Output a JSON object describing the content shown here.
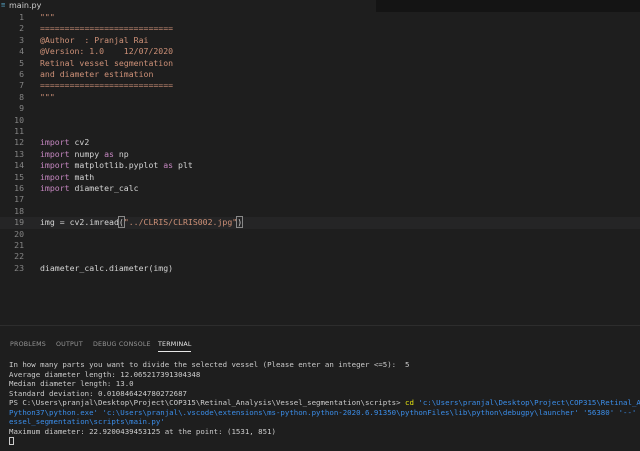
{
  "tab": {
    "file_name": "main.py"
  },
  "editor": {
    "lines": [
      {
        "n": "1",
        "segments": [
          {
            "t": "\"\"\"",
            "c": "str"
          }
        ]
      },
      {
        "n": "2",
        "segments": [
          {
            "t": "===========================",
            "c": "str"
          }
        ]
      },
      {
        "n": "3",
        "segments": [
          {
            "t": "@Author  : Pranjal Rai",
            "c": "str"
          }
        ]
      },
      {
        "n": "4",
        "segments": [
          {
            "t": "@Version: 1.0    12/07/2020",
            "c": "str"
          }
        ]
      },
      {
        "n": "5",
        "segments": [
          {
            "t": "Retinal vessel segmentation",
            "c": "str"
          }
        ]
      },
      {
        "n": "6",
        "segments": [
          {
            "t": "and diameter estimation",
            "c": "str"
          }
        ]
      },
      {
        "n": "7",
        "segments": [
          {
            "t": "===========================",
            "c": "str"
          }
        ]
      },
      {
        "n": "8",
        "segments": [
          {
            "t": "\"\"\"",
            "c": "str"
          }
        ]
      },
      {
        "n": "9",
        "segments": []
      },
      {
        "n": "10",
        "segments": []
      },
      {
        "n": "11",
        "segments": []
      },
      {
        "n": "12",
        "segments": [
          {
            "t": "import",
            "c": "kw"
          },
          {
            "t": " cv2",
            "c": ""
          }
        ]
      },
      {
        "n": "13",
        "segments": [
          {
            "t": "import",
            "c": "kw"
          },
          {
            "t": " numpy ",
            "c": ""
          },
          {
            "t": "as",
            "c": "kw"
          },
          {
            "t": " np",
            "c": ""
          }
        ]
      },
      {
        "n": "14",
        "segments": [
          {
            "t": "import",
            "c": "kw"
          },
          {
            "t": " matplotlib.pyplot ",
            "c": ""
          },
          {
            "t": "as",
            "c": "kw"
          },
          {
            "t": " plt",
            "c": ""
          }
        ]
      },
      {
        "n": "15",
        "segments": [
          {
            "t": "import",
            "c": "kw"
          },
          {
            "t": " math",
            "c": ""
          }
        ]
      },
      {
        "n": "16",
        "segments": [
          {
            "t": "import",
            "c": "kw"
          },
          {
            "t": " diameter_calc",
            "c": ""
          }
        ]
      },
      {
        "n": "17",
        "segments": []
      },
      {
        "n": "18",
        "segments": []
      },
      {
        "n": "19",
        "segments": [
          {
            "t": "img = cv2.imread",
            "c": ""
          },
          {
            "t": "(",
            "c": "box"
          },
          {
            "t": "\"../CLRIS/CLRIS002.jpg\"",
            "c": "str"
          },
          {
            "t": ")",
            "c": "box"
          }
        ],
        "current": true
      },
      {
        "n": "20",
        "segments": []
      },
      {
        "n": "21",
        "segments": []
      },
      {
        "n": "22",
        "segments": []
      },
      {
        "n": "23",
        "segments": [
          {
            "t": "diameter_calc.diameter(img)",
            "c": ""
          }
        ]
      }
    ]
  },
  "panel": {
    "tabs": [
      {
        "label": "PROBLEMS",
        "active": false
      },
      {
        "label": "OUTPUT",
        "active": false
      },
      {
        "label": "DEBUG CONSOLE",
        "active": false
      },
      {
        "label": "TERMINAL",
        "active": true
      }
    ],
    "terminal_lines": [
      "In how many parts you want to divide the selected vessel (Please enter an integer <=5):  5",
      "Average diameter length: 12.065217391304348",
      "Median diameter length: 13.0",
      "Standard deviation: 0.010846424780272687",
      "PS C:\\Users\\pranjal\\Desktop\\Project\\COP315\\Retinal_Analysis\\Vessel_segmentation\\scripts>",
      "Python37\\python.exe' 'c:\\Users\\pranjal\\.vscode\\extensions\\ms-python.python-2020.6.91350\\pythonFiles\\lib\\python\\debugpy\\launcher' '56380' '--'",
      "essel_segmentation\\scripts\\main.py'",
      "Maximum diameter: 22.9200439453125 at the point: (1531, 851)"
    ],
    "ps_command": " cd ",
    "ps_command_arg": "'c:\\Users\\pranjal\\Desktop\\Project\\COP315\\Retinal_A"
  },
  "colors": {
    "background": "#1e1e1e",
    "line_number": "#858585",
    "keyword": "#c586c0",
    "string": "#ce9178",
    "text": "#d4d4d4",
    "current_line": "#252526"
  }
}
